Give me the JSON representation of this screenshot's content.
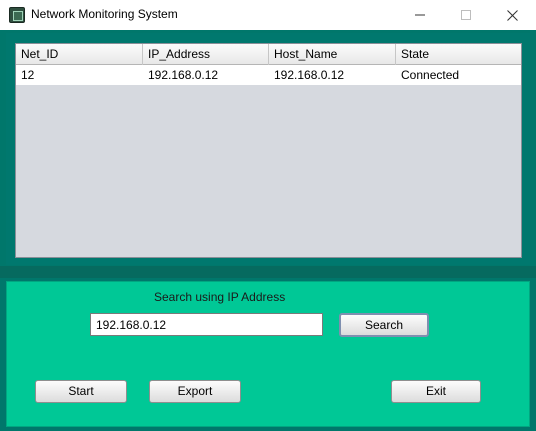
{
  "window": {
    "title": "Network Monitoring System",
    "controls": [
      "minimize",
      "maximize",
      "close"
    ]
  },
  "table": {
    "columns": [
      "Net_ID",
      "IP_Address",
      "Host_Name",
      "State"
    ],
    "rows": [
      [
        "12",
        "192.168.0.12",
        "192.168.0.12",
        "Connected"
      ]
    ]
  },
  "search": {
    "label": "Search using IP Address",
    "value": "192.168.0.12",
    "button_label": "Search"
  },
  "actions": {
    "start_label": "Start",
    "export_label": "Export",
    "exit_label": "Exit"
  },
  "colors": {
    "frame": "#00776b",
    "bottom_panel": "#00c896",
    "table_bg": "#d6d9df"
  }
}
